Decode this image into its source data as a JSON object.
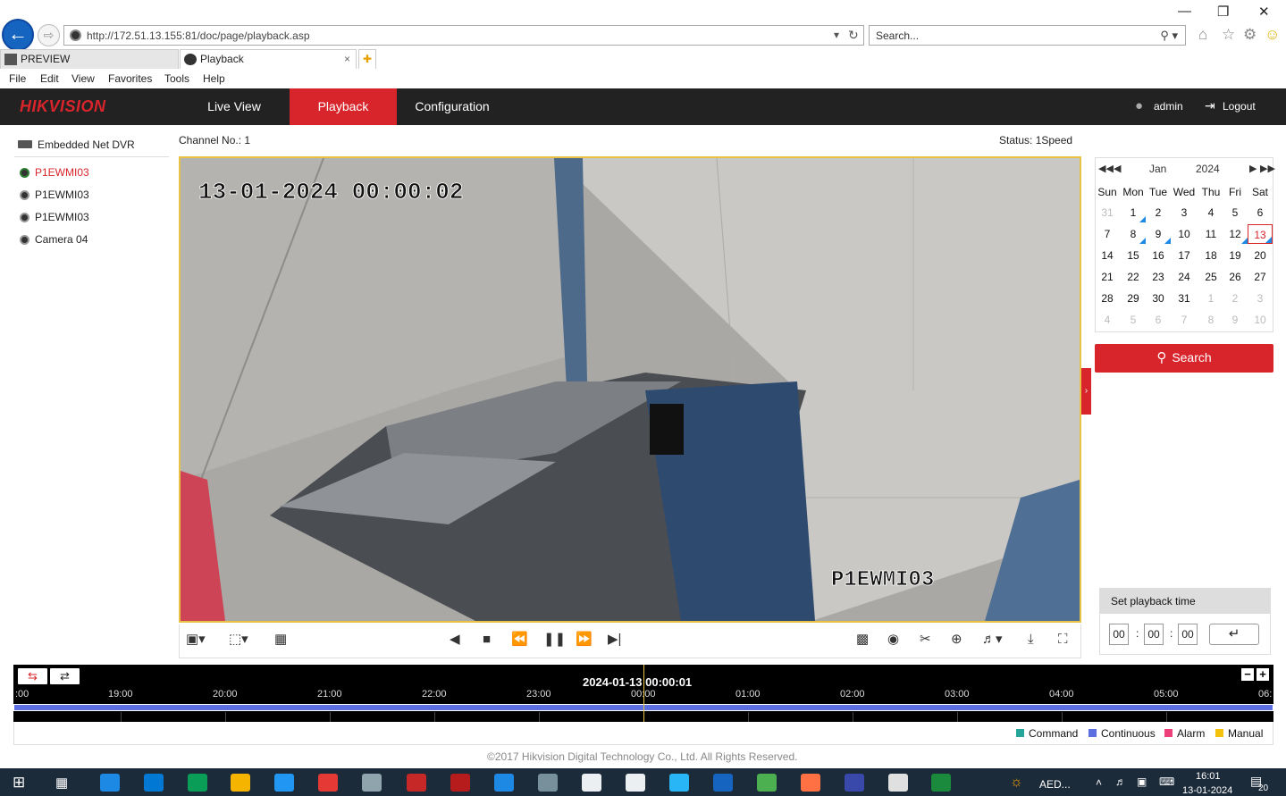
{
  "browser": {
    "url": "http://172.51.13.155:81/doc/page/playback.asp",
    "search_placeholder": "Search...",
    "tabs": [
      {
        "label": "PREVIEW"
      },
      {
        "label": "Playback"
      }
    ],
    "menu": [
      "File",
      "Edit",
      "View",
      "Favorites",
      "Tools",
      "Help"
    ]
  },
  "app": {
    "logo": "HIKVISION",
    "nav": [
      "Live View",
      "Playback",
      "Configuration"
    ],
    "active_nav": "Playback",
    "user": "admin",
    "logout": "Logout",
    "accent": "#d8242b"
  },
  "device_tree": {
    "root": "Embedded Net DVR",
    "cameras": [
      "P1EWMI03",
      "P1EWMI03",
      "P1EWMI03",
      "Camera 04"
    ],
    "selected_index": 0
  },
  "player": {
    "channel": "Channel No.: 1",
    "status": "Status: 1Speed",
    "osd_timestamp": "13-01-2024 00:00:02",
    "osd_camera_name": "P1EWMI03",
    "controls": [
      "window-layout-icon",
      "capture-region-icon",
      "digital-zoom-icon",
      "prev-frame-icon",
      "stop-icon",
      "slow-icon",
      "pause-icon",
      "fast-icon",
      "next-frame-icon",
      "clip-icon",
      "snapshot-icon",
      "scissors-icon",
      "zoom-in-icon",
      "audio-icon",
      "download-icon",
      "fullscreen-icon"
    ]
  },
  "calendar": {
    "month": "Jan",
    "year": "2024",
    "weekdays": [
      "Sun",
      "Mon",
      "Tue",
      "Wed",
      "Thu",
      "Fri",
      "Sat"
    ],
    "weeks": [
      [
        "31",
        "1",
        "2",
        "3",
        "4",
        "5",
        "6"
      ],
      [
        "7",
        "8",
        "9",
        "10",
        "11",
        "12",
        "13"
      ],
      [
        "14",
        "15",
        "16",
        "17",
        "18",
        "19",
        "20"
      ],
      [
        "21",
        "22",
        "23",
        "24",
        "25",
        "26",
        "27"
      ],
      [
        "28",
        "29",
        "30",
        "31",
        "1",
        "2",
        "3"
      ],
      [
        "4",
        "5",
        "6",
        "7",
        "8",
        "9",
        "10"
      ]
    ],
    "selected_day": "13",
    "recorded_days": [
      "1",
      "8",
      "9",
      "12",
      "13"
    ],
    "search_label": "Search"
  },
  "playback_time": {
    "title": "Set playback time",
    "hh": "00",
    "mm": "00",
    "ss": "00"
  },
  "timeline": {
    "current": "2024-01-13 00:00:01",
    "ticks": [
      ":00",
      "19:00",
      "20:00",
      "21:00",
      "22:00",
      "23:00",
      "00:00",
      "01:00",
      "02:00",
      "03:00",
      "04:00",
      "05:00",
      "06:"
    ],
    "legend": [
      {
        "label": "Command",
        "color": "#26a69a"
      },
      {
        "label": "Continuous",
        "color": "#5b6fe0"
      },
      {
        "label": "Alarm",
        "color": "#ec407a"
      },
      {
        "label": "Manual",
        "color": "#f4c20d"
      }
    ]
  },
  "footer": "©2017 Hikvision Digital Technology Co., Ltd. All Rights Reserved.",
  "taskbar": {
    "aed": "AED...",
    "time": "16:01",
    "date": "13-01-2024",
    "notifications": "20"
  }
}
